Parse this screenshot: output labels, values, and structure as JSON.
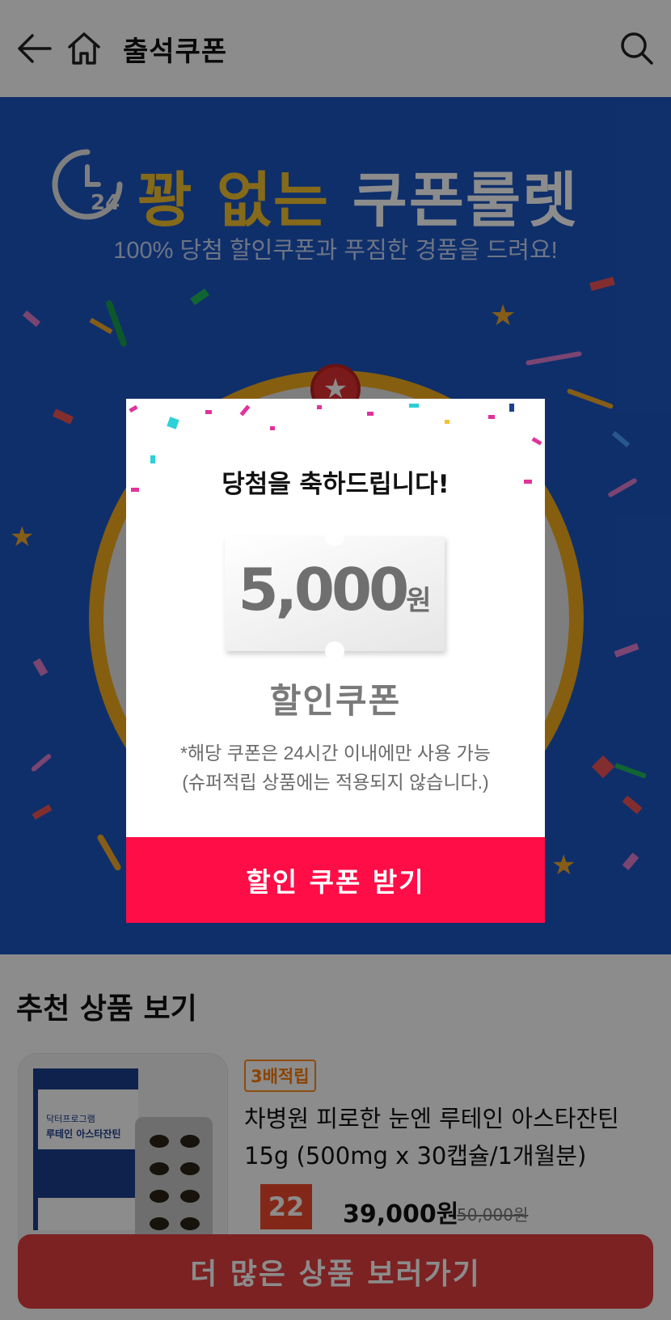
{
  "header": {
    "title": "출석쿠폰",
    "back_icon": "back-arrow-icon",
    "home_icon": "home-icon",
    "search_icon": "search-icon"
  },
  "banner": {
    "clock_label": "24",
    "title_highlight": "꽝 없는",
    "title_main": "쿠폰룰렛",
    "subtitle": "100% 당첨 할인쿠폰과 푸짐한 경품을 드려요!"
  },
  "modal": {
    "heading": "당첨을 축하드립니다!",
    "coupon_amount": "5,000",
    "coupon_unit": "원",
    "coupon_type": "할인쿠폰",
    "note_line1": "*해당 쿠폰은 24시간 이내에만 사용 가능",
    "note_line2": "(슈퍼적립 상품에는 적용되지 않습니다.)",
    "button_label": "할인 쿠폰 받기"
  },
  "recommend": {
    "title": "추천 상품 보기",
    "product": {
      "badge": "3배적립",
      "name": "차병원 피로한 눈엔 루테인 아스타잔틴 15g (500mg x 30캡슐/1개월분)",
      "discount": "22",
      "price": "39,000원",
      "original_price": "50,000원",
      "box_brand": "닥터프로그램",
      "box_title": "루테인 아스타잔틴"
    },
    "more_button": "더 많은 상품 보러가기"
  },
  "colors": {
    "banner_blue": "#1d57c4",
    "gold": "#f2c230",
    "modal_button": "#ff0d47",
    "more_button": "#e23f3f",
    "badge_orange": "#ff7b00"
  }
}
